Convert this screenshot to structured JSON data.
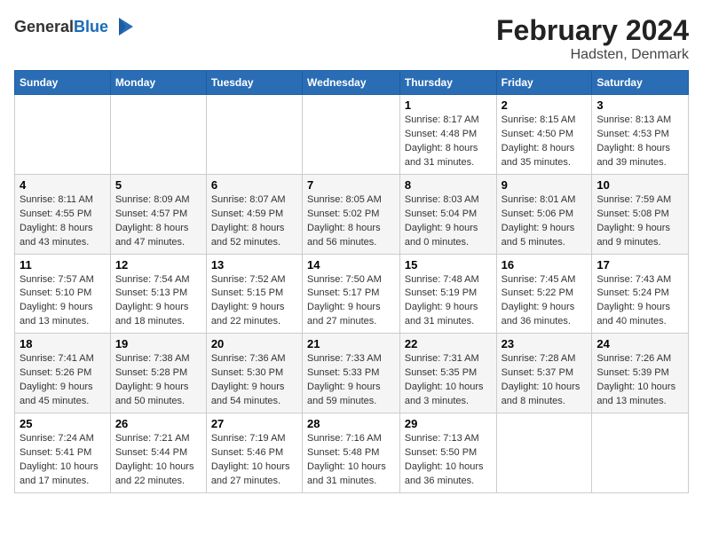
{
  "app": {
    "logo_general": "General",
    "logo_blue": "Blue",
    "title": "February 2024",
    "subtitle": "Hadsten, Denmark"
  },
  "headers": [
    "Sunday",
    "Monday",
    "Tuesday",
    "Wednesday",
    "Thursday",
    "Friday",
    "Saturday"
  ],
  "weeks": [
    [
      {
        "day": "",
        "info": ""
      },
      {
        "day": "",
        "info": ""
      },
      {
        "day": "",
        "info": ""
      },
      {
        "day": "",
        "info": ""
      },
      {
        "day": "1",
        "info": "Sunrise: 8:17 AM\nSunset: 4:48 PM\nDaylight: 8 hours\nand 31 minutes."
      },
      {
        "day": "2",
        "info": "Sunrise: 8:15 AM\nSunset: 4:50 PM\nDaylight: 8 hours\nand 35 minutes."
      },
      {
        "day": "3",
        "info": "Sunrise: 8:13 AM\nSunset: 4:53 PM\nDaylight: 8 hours\nand 39 minutes."
      }
    ],
    [
      {
        "day": "4",
        "info": "Sunrise: 8:11 AM\nSunset: 4:55 PM\nDaylight: 8 hours\nand 43 minutes."
      },
      {
        "day": "5",
        "info": "Sunrise: 8:09 AM\nSunset: 4:57 PM\nDaylight: 8 hours\nand 47 minutes."
      },
      {
        "day": "6",
        "info": "Sunrise: 8:07 AM\nSunset: 4:59 PM\nDaylight: 8 hours\nand 52 minutes."
      },
      {
        "day": "7",
        "info": "Sunrise: 8:05 AM\nSunset: 5:02 PM\nDaylight: 8 hours\nand 56 minutes."
      },
      {
        "day": "8",
        "info": "Sunrise: 8:03 AM\nSunset: 5:04 PM\nDaylight: 9 hours\nand 0 minutes."
      },
      {
        "day": "9",
        "info": "Sunrise: 8:01 AM\nSunset: 5:06 PM\nDaylight: 9 hours\nand 5 minutes."
      },
      {
        "day": "10",
        "info": "Sunrise: 7:59 AM\nSunset: 5:08 PM\nDaylight: 9 hours\nand 9 minutes."
      }
    ],
    [
      {
        "day": "11",
        "info": "Sunrise: 7:57 AM\nSunset: 5:10 PM\nDaylight: 9 hours\nand 13 minutes."
      },
      {
        "day": "12",
        "info": "Sunrise: 7:54 AM\nSunset: 5:13 PM\nDaylight: 9 hours\nand 18 minutes."
      },
      {
        "day": "13",
        "info": "Sunrise: 7:52 AM\nSunset: 5:15 PM\nDaylight: 9 hours\nand 22 minutes."
      },
      {
        "day": "14",
        "info": "Sunrise: 7:50 AM\nSunset: 5:17 PM\nDaylight: 9 hours\nand 27 minutes."
      },
      {
        "day": "15",
        "info": "Sunrise: 7:48 AM\nSunset: 5:19 PM\nDaylight: 9 hours\nand 31 minutes."
      },
      {
        "day": "16",
        "info": "Sunrise: 7:45 AM\nSunset: 5:22 PM\nDaylight: 9 hours\nand 36 minutes."
      },
      {
        "day": "17",
        "info": "Sunrise: 7:43 AM\nSunset: 5:24 PM\nDaylight: 9 hours\nand 40 minutes."
      }
    ],
    [
      {
        "day": "18",
        "info": "Sunrise: 7:41 AM\nSunset: 5:26 PM\nDaylight: 9 hours\nand 45 minutes."
      },
      {
        "day": "19",
        "info": "Sunrise: 7:38 AM\nSunset: 5:28 PM\nDaylight: 9 hours\nand 50 minutes."
      },
      {
        "day": "20",
        "info": "Sunrise: 7:36 AM\nSunset: 5:30 PM\nDaylight: 9 hours\nand 54 minutes."
      },
      {
        "day": "21",
        "info": "Sunrise: 7:33 AM\nSunset: 5:33 PM\nDaylight: 9 hours\nand 59 minutes."
      },
      {
        "day": "22",
        "info": "Sunrise: 7:31 AM\nSunset: 5:35 PM\nDaylight: 10 hours\nand 3 minutes."
      },
      {
        "day": "23",
        "info": "Sunrise: 7:28 AM\nSunset: 5:37 PM\nDaylight: 10 hours\nand 8 minutes."
      },
      {
        "day": "24",
        "info": "Sunrise: 7:26 AM\nSunset: 5:39 PM\nDaylight: 10 hours\nand 13 minutes."
      }
    ],
    [
      {
        "day": "25",
        "info": "Sunrise: 7:24 AM\nSunset: 5:41 PM\nDaylight: 10 hours\nand 17 minutes."
      },
      {
        "day": "26",
        "info": "Sunrise: 7:21 AM\nSunset: 5:44 PM\nDaylight: 10 hours\nand 22 minutes."
      },
      {
        "day": "27",
        "info": "Sunrise: 7:19 AM\nSunset: 5:46 PM\nDaylight: 10 hours\nand 27 minutes."
      },
      {
        "day": "28",
        "info": "Sunrise: 7:16 AM\nSunset: 5:48 PM\nDaylight: 10 hours\nand 31 minutes."
      },
      {
        "day": "29",
        "info": "Sunrise: 7:13 AM\nSunset: 5:50 PM\nDaylight: 10 hours\nand 36 minutes."
      },
      {
        "day": "",
        "info": ""
      },
      {
        "day": "",
        "info": ""
      }
    ]
  ]
}
